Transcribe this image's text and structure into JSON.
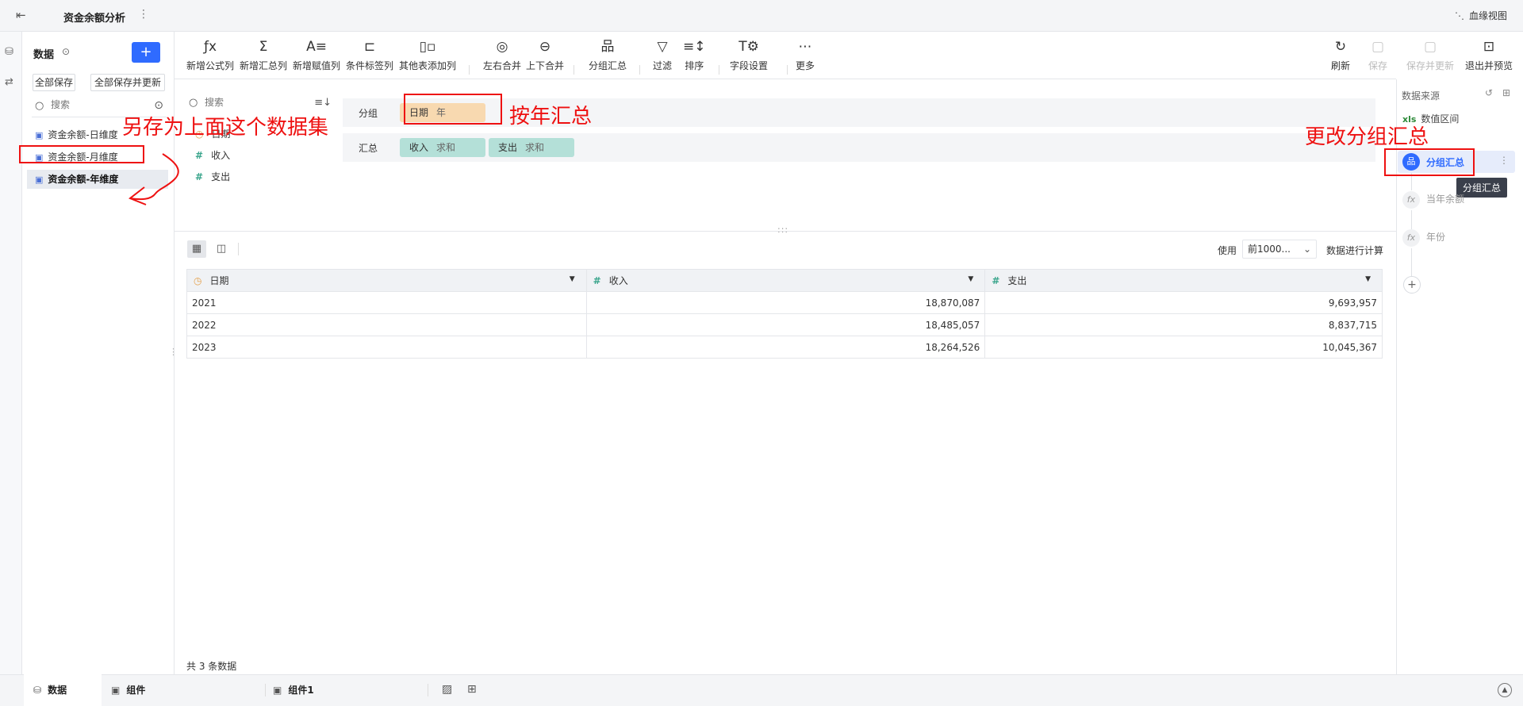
{
  "topbar": {
    "title": "资金余额分析",
    "more": "⋮",
    "lineage_label": "血缘视图"
  },
  "datapanel": {
    "header": "数据",
    "save_all": "全部保存",
    "save_all_update": "全部保存并更新",
    "search_placeholder": "搜索",
    "items": [
      {
        "label": "资金余额-日维度"
      },
      {
        "label": "资金余额-月维度"
      },
      {
        "label": "资金余额-年维度"
      }
    ]
  },
  "toolbar": {
    "items": [
      {
        "label": "新增公式列",
        "icon": "fx-icon"
      },
      {
        "label": "新增汇总列",
        "icon": "sigma-icon"
      },
      {
        "label": "新增赋值列",
        "icon": "assign-icon"
      },
      {
        "label": "条件标签列",
        "icon": "condition-icon"
      },
      {
        "label": "其他表添加列",
        "icon": "add-column-icon"
      },
      {
        "label": "左右合并",
        "icon": "merge-lr-icon"
      },
      {
        "label": "上下合并",
        "icon": "merge-tb-icon"
      },
      {
        "label": "分组汇总",
        "icon": "group-icon"
      },
      {
        "label": "过滤",
        "icon": "filter-icon"
      },
      {
        "label": "排序",
        "icon": "sort-icon"
      },
      {
        "label": "字段设置",
        "icon": "field-settings-icon"
      },
      {
        "label": "更多",
        "icon": "more-icon"
      }
    ],
    "right": [
      {
        "label": "刷新",
        "icon": "refresh-icon"
      },
      {
        "label": "保存",
        "icon": "save-icon"
      },
      {
        "label": "保存并更新",
        "icon": "save-update-icon"
      },
      {
        "label": "退出并预览",
        "icon": "exit-preview-icon"
      }
    ]
  },
  "fieldlist": {
    "search_placeholder": "搜索",
    "fields": [
      {
        "label": "日期",
        "type": "date"
      },
      {
        "label": "收入",
        "type": "number"
      },
      {
        "label": "支出",
        "type": "number"
      }
    ]
  },
  "config": {
    "group_label": "分组",
    "group_chip": {
      "field": "日期",
      "sub": "年"
    },
    "summary_label": "汇总",
    "summary_chips": [
      {
        "field": "收入",
        "sub": "求和"
      },
      {
        "field": "支出",
        "sub": "求和"
      }
    ]
  },
  "preview": {
    "use_label": "使用",
    "limit_value": "前1000...",
    "calc_label": "数据进行计算",
    "columns": [
      "日期",
      "收入",
      "支出"
    ],
    "rows": [
      [
        "2021",
        "18,870,087",
        "9,693,957"
      ],
      [
        "2022",
        "18,485,057",
        "8,837,715"
      ],
      [
        "2023",
        "18,264,526",
        "10,045,367"
      ]
    ],
    "row_count": "共 3 条数据"
  },
  "rightpanel": {
    "title": "数据来源",
    "source_icon_text": "xls",
    "source_label": "数值区间",
    "active_step": "分组汇总",
    "tooltip": "分组汇总",
    "steps": [
      {
        "label": "当年余额"
      },
      {
        "label": "年份"
      }
    ],
    "add": "+"
  },
  "bottom_tabs": [
    {
      "label": "数据"
    },
    {
      "label": "组件"
    },
    {
      "label": "组件1"
    }
  ],
  "annotations": {
    "save_as": "另存为上面这个数据集",
    "by_year": "按年汇总",
    "change_group": "更改分组汇总"
  },
  "colors": {
    "accent": "#2f6bff",
    "annotation": "#ee1111",
    "chip_orange": "#f8d9b0",
    "chip_teal": "#b4e0d8"
  }
}
